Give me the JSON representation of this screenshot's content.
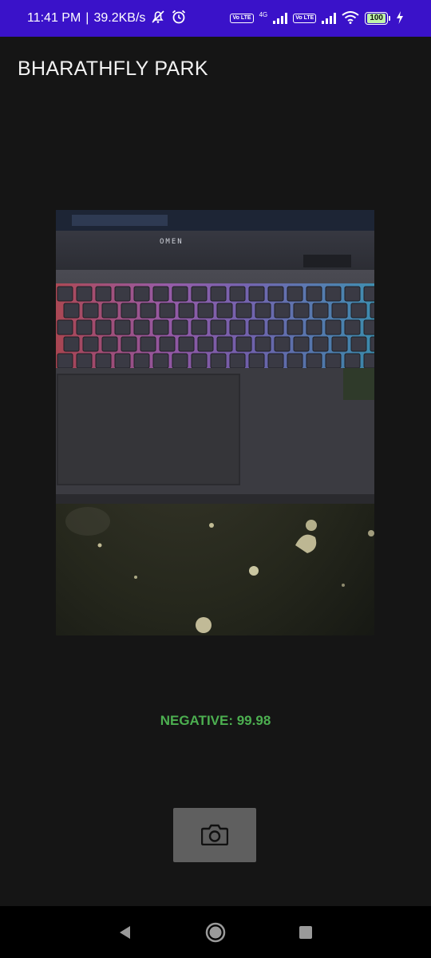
{
  "status_bar": {
    "time": "11:41 PM",
    "separator": "|",
    "net_speed": "39.2KB/s",
    "sim1_label": "Vo LTE",
    "network_type": "4G",
    "sim2_label": "Vo LTE",
    "battery_level": "100",
    "icons": [
      "muted-alarm-icon",
      "alarm-icon",
      "signal-icon",
      "wifi-icon",
      "battery-icon",
      "charging-icon"
    ]
  },
  "app_bar": {
    "title": "BHARATHFLY PARK"
  },
  "image": {
    "laptop_brand": "OMEN"
  },
  "result": {
    "text": "NEGATIVE: 99.98"
  },
  "camera_button": {
    "icon": "camera-icon"
  },
  "nav_bar": {
    "back_icon": "back-icon",
    "home_icon": "home-icon",
    "recents_icon": "recents-icon"
  },
  "colors": {
    "status_bar_bg": "#3a12c9",
    "background": "#151515",
    "result_text": "#4caf50",
    "button_bg": "#5f5f5f"
  }
}
